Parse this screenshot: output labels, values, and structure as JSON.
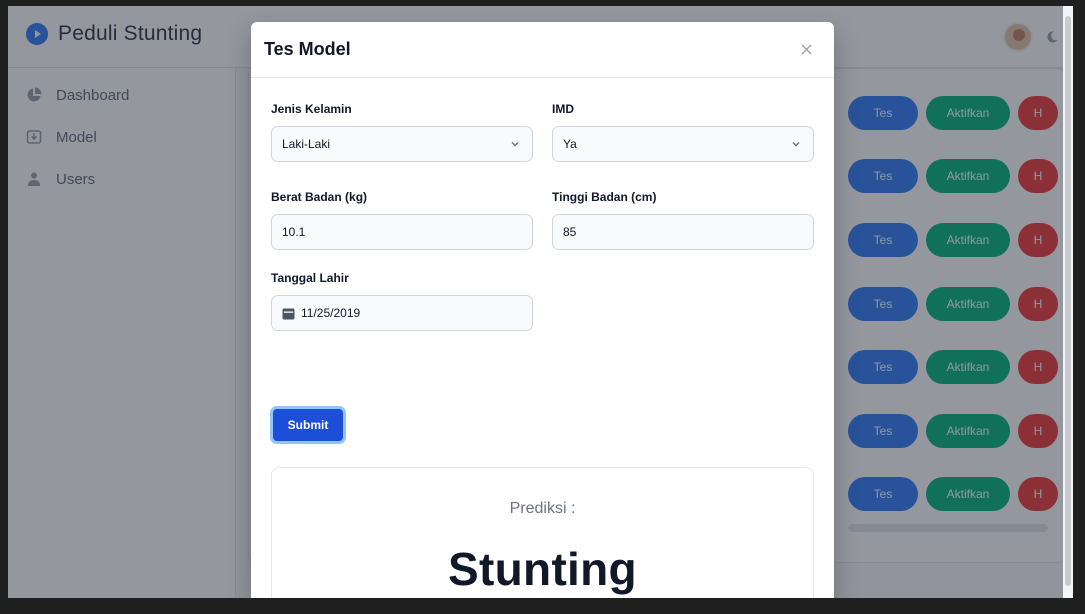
{
  "app": {
    "brand": "Peduli Stunting"
  },
  "sidebar": {
    "items": [
      {
        "label": "Dashboard",
        "icon": "chart-pie-icon"
      },
      {
        "label": "Model",
        "icon": "upload-box-icon"
      },
      {
        "label": "Users",
        "icon": "user-icon"
      }
    ]
  },
  "table": {
    "row_actions": [
      {
        "tes": "Tes",
        "aktifkan": "Aktifkan",
        "hapus": "H"
      },
      {
        "tes": "Tes",
        "aktifkan": "Aktifkan",
        "hapus": "H"
      },
      {
        "tes": "Tes",
        "aktifkan": "Aktifkan",
        "hapus": "H"
      },
      {
        "tes": "Tes",
        "aktifkan": "Aktifkan",
        "hapus": "H"
      },
      {
        "tes": "Tes",
        "aktifkan": "Aktifkan",
        "hapus": "H"
      },
      {
        "tes": "Tes",
        "aktifkan": "Aktifkan",
        "hapus": "H"
      },
      {
        "tes": "Tes",
        "aktifkan": "Aktifkan",
        "hapus": "H"
      }
    ]
  },
  "modal": {
    "title": "Tes Model",
    "fields": {
      "jenis_kelamin": {
        "label": "Jenis Kelamin",
        "value": "Laki-Laki"
      },
      "imd": {
        "label": "IMD",
        "value": "Ya"
      },
      "berat_badan": {
        "label": "Berat Badan (kg)",
        "value": "10.1"
      },
      "tinggi_badan": {
        "label": "Tinggi Badan (cm)",
        "value": "85"
      },
      "tanggal_lahir": {
        "label": "Tanggal Lahir",
        "value": "11/25/2019"
      }
    },
    "submit_label": "Submit",
    "result": {
      "label": "Prediksi :",
      "value": "Stunting"
    }
  },
  "colors": {
    "primary": "#1d4ed8",
    "tes_button": "#3b82f6",
    "aktifkan_button": "#10b981",
    "hapus_button": "#ef4444"
  }
}
